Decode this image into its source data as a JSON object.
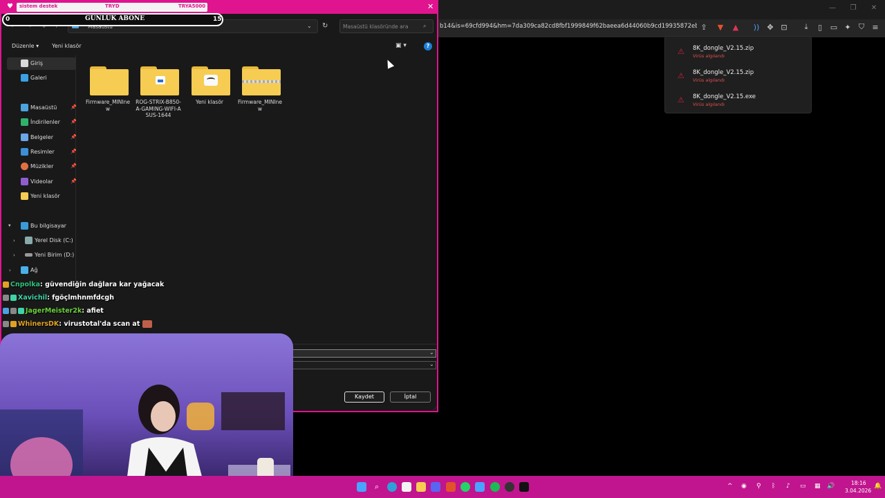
{
  "dialog": {
    "overlay_left": "sistem destek",
    "overlay_mid": "TRYD",
    "overlay_right": "TRYA5000",
    "goal_left": "0",
    "goal_title": "GÜNLÜK ABONE",
    "goal_right": "15",
    "breadcrumb": "Masaüstü",
    "search_placeholder": "Masaüstü klasöründe ara",
    "organize": "Düzenle",
    "new_folder": "Yeni klasör",
    "save_label": "Kaydet",
    "cancel_label": "İptal"
  },
  "sidebar": {
    "items": [
      {
        "label": "Giriş",
        "icon": "home-icon",
        "color": "#d9d9d9"
      },
      {
        "label": "Galeri",
        "icon": "gallery-icon",
        "color": "#3aa0e6"
      },
      {
        "label": "Masaüstü",
        "icon": "desktop-icon",
        "color": "#4aa3df"
      },
      {
        "label": "İndirilenler",
        "icon": "download-icon",
        "color": "#2fb36b"
      },
      {
        "label": "Belgeler",
        "icon": "documents-icon",
        "color": "#6aa6e8"
      },
      {
        "label": "Resimler",
        "icon": "pictures-icon",
        "color": "#3b8fd6"
      },
      {
        "label": "Müzikler",
        "icon": "music-icon",
        "color": "#e07044"
      },
      {
        "label": "Videolar",
        "icon": "videos-icon",
        "color": "#8e5ed1"
      },
      {
        "label": "Yeni klasör",
        "icon": "folder-icon",
        "color": "#f6cc53"
      },
      {
        "label": "Bu bilgisayar",
        "icon": "computer-icon",
        "color": "#3a9ad9"
      },
      {
        "label": "Yerel Disk (C:)",
        "icon": "drive-icon",
        "color": "#8aa"
      },
      {
        "label": "Yeni Birim (D:)",
        "icon": "drive-icon",
        "color": "#999"
      },
      {
        "label": "Ağ",
        "icon": "network-icon",
        "color": "#4ab0e8"
      }
    ]
  },
  "files": [
    {
      "name": "Firmware_MINInew"
    },
    {
      "name": "ROG-STRIX-B850-A-GAMING-WIFI-ASUS-1644"
    },
    {
      "name": "Yeni klasör"
    },
    {
      "name": "Firmware_MINInew"
    }
  ],
  "chat": [
    {
      "user": "Cnpolka",
      "message": ": güvendiğin dağlara kar yağacak",
      "color": "#2ec27e"
    },
    {
      "user": "Xavichil",
      "message": ": fgöçlmhnmfdcgh",
      "color": "#3fd3a6"
    },
    {
      "user": "JagerMeister2k",
      "message": ": afiet",
      "color": "#6ad13a"
    },
    {
      "user": "WhinersDK",
      "message": ": virustotal'da scan at",
      "color": "#e0a224"
    }
  ],
  "browser": {
    "url": "b14&is=69cfd994&hm=7da309ca82cd8fbf1999849f62baeea6d44060b9cd19935872ebc..."
  },
  "downloads": [
    {
      "name": "8K_dongle_V2.15.zip",
      "status": "Virüs algılandı"
    },
    {
      "name": "8K_dongle_V2.15.zip",
      "status": "Virüs algılandı"
    },
    {
      "name": "8K_dongle_V2.15.exe",
      "status": "Virüs algılandı"
    }
  ],
  "taskbar": {
    "time": "18:16",
    "date": "3.04.2026"
  }
}
